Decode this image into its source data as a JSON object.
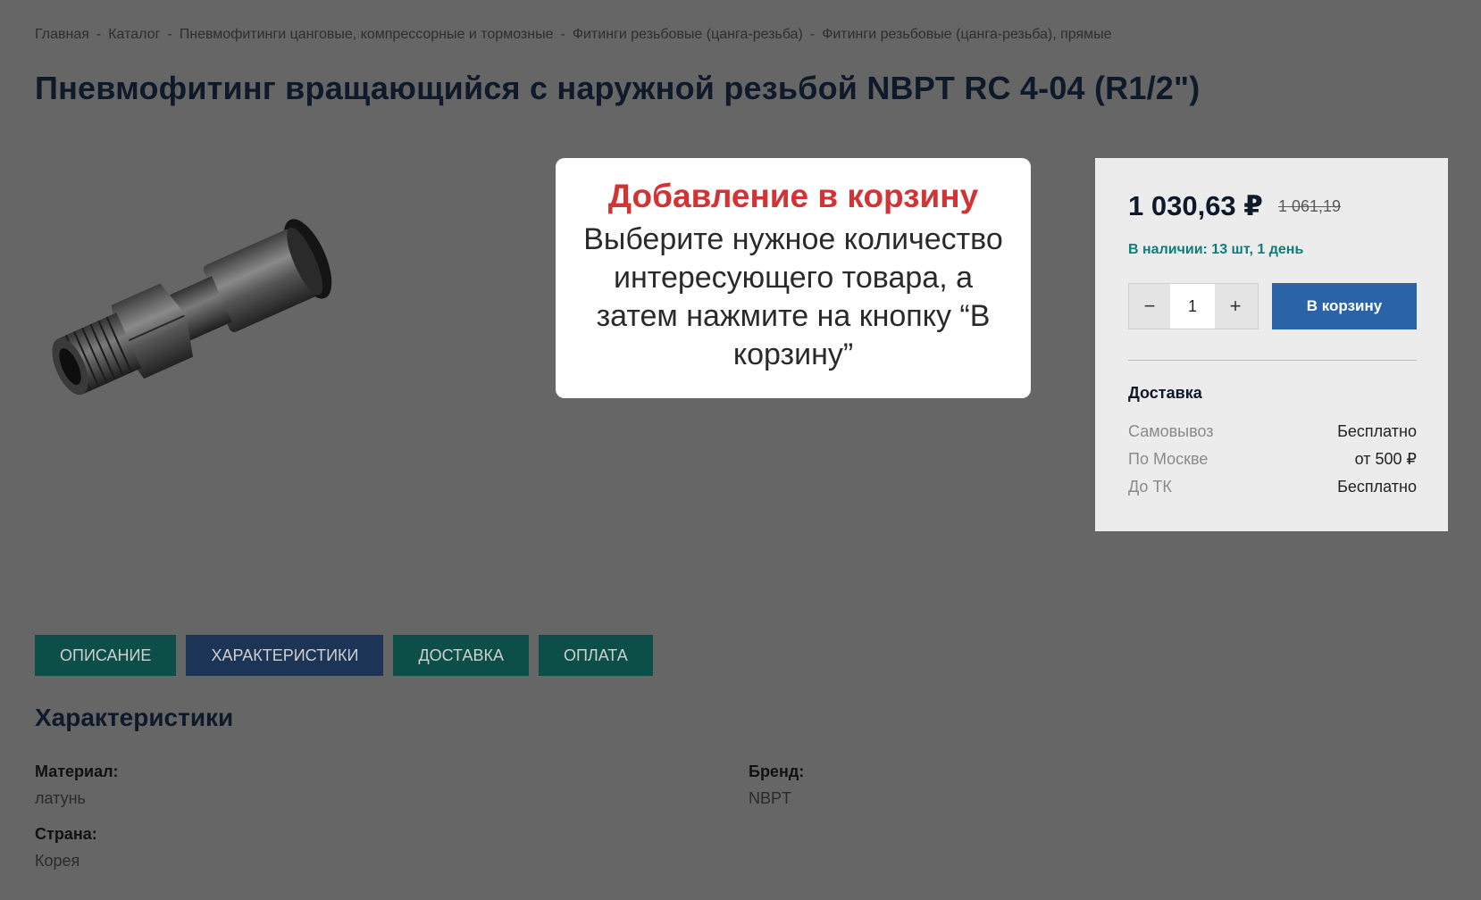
{
  "breadcrumb": [
    "Главная",
    "Каталог",
    "Пневмофитинги цанговые, компрессорные и тормозные",
    "Фитинги резьбовые (цанга-резьба)",
    "Фитинги резьбовые (цанга-резьба), прямые"
  ],
  "breadcrumb_separator": "-",
  "title": "Пневмофитинг вращающийся с наружной резьбой NBPT RC 4-04 (R1/2\")",
  "buy": {
    "price": "1 030,63 ₽",
    "old_price": "1 061,19",
    "stock": "В наличии: 13 шт, 1 день",
    "qty_minus": "−",
    "qty_value": "1",
    "qty_plus": "+",
    "cart_button": "В корзину",
    "delivery_title": "Доставка",
    "delivery": [
      {
        "label": "Самовывоз",
        "value": "Бесплатно"
      },
      {
        "label": "По Москве",
        "value": "от 500 ₽"
      },
      {
        "label": "До ТК",
        "value": "Бесплатно"
      }
    ]
  },
  "modal": {
    "title": "Добавление в корзину",
    "text": "Выберите нужное количество интересующего товара, а затем нажмите на кнопку “В корзину”"
  },
  "tabs": [
    "ОПИСАНИЕ",
    "ХАРАКТЕРИСТИКИ",
    "ДОСТАВКА",
    "ОПЛАТА"
  ],
  "specs_title": "Характеристики",
  "specs": [
    {
      "label": "Материал:",
      "value": "латунь"
    },
    {
      "label": "Бренд:",
      "value": "NBPT"
    },
    {
      "label": "Страна:",
      "value": "Корея"
    }
  ],
  "colors": {
    "overlay_bg": "#666666",
    "accent_red": "#d13434",
    "cart_button": "#2a64a6",
    "stock_text": "#0a7f7a",
    "tab_teal": "#0b4f48",
    "tab_navy": "#1c3456"
  }
}
